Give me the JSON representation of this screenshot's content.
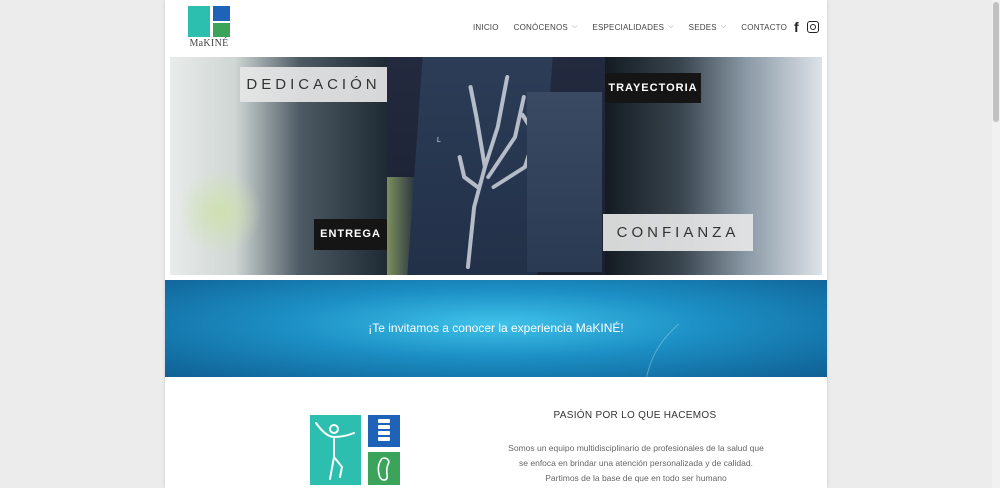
{
  "brand": {
    "logo_text": "MaKINÉ"
  },
  "nav": {
    "items": [
      {
        "label": "INICIO",
        "has_dropdown": false
      },
      {
        "label": "CONÓCENOS",
        "has_dropdown": true
      },
      {
        "label": "ESPECIALIDADES",
        "has_dropdown": true
      },
      {
        "label": "SEDES",
        "has_dropdown": true
      },
      {
        "label": "CONTACTO",
        "has_dropdown": false
      }
    ],
    "social": [
      "facebook-icon",
      "instagram-icon"
    ],
    "facebook_glyph": "f"
  },
  "hero": {
    "tags": {
      "dedicacion": "DEDICACIÓN",
      "entrega": "ENTREGA",
      "trayectoria": "TRAYECTORIA",
      "confianza": "CONFIANZA"
    }
  },
  "banner": {
    "text": "¡Te invitamos a conocer la experiencia MaKINÉ!"
  },
  "about": {
    "title": "PASIÓN POR LO QUE HACEMOS",
    "body": "Somos un equipo multidisciplinario de profesionales de la salud que se enfoca en brindar una atención personalizada y de calidad. Partimos de la base de que en todo ser humano"
  },
  "colors": {
    "teal": "#2cbfb0",
    "blue": "#1f63b8",
    "green": "#3ca35a",
    "banner": "#1c8fc4"
  }
}
